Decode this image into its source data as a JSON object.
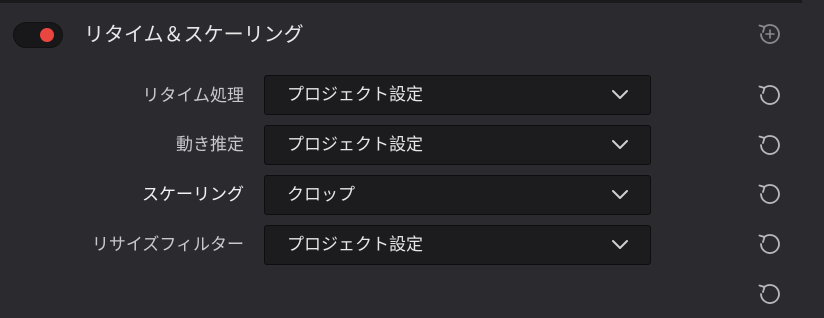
{
  "section": {
    "title": "リタイム＆スケーリング",
    "enabled": true,
    "toggle_color": "#e8463f"
  },
  "rows": [
    {
      "label": "リタイム処理",
      "value": "プロジェクト設定"
    },
    {
      "label": "動き推定",
      "value": "プロジェクト設定"
    },
    {
      "label": "スケーリング",
      "value": "クロップ"
    },
    {
      "label": "リサイズフィルター",
      "value": "プロジェクト設定"
    }
  ],
  "icons": {
    "section_reset": "reset-add-icon",
    "row_reset": "undo-reset-icon",
    "dropdown": "chevron-down-icon"
  }
}
